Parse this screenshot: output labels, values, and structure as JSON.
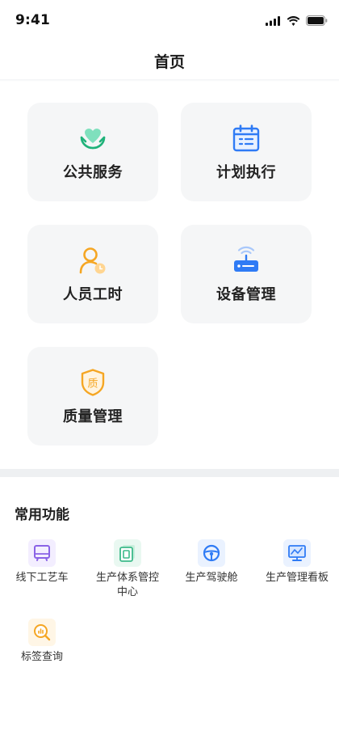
{
  "status_bar": {
    "time": "9:41"
  },
  "nav": {
    "title": "首页"
  },
  "tiles": [
    {
      "label": "公共服务",
      "icon": "heart-hands-icon",
      "color": "#3fcf9a"
    },
    {
      "label": "计划执行",
      "icon": "calendar-icon",
      "color": "#2f7bf5"
    },
    {
      "label": "人员工时",
      "icon": "person-clock-icon",
      "color": "#f5a623"
    },
    {
      "label": "设备管理",
      "icon": "router-device-icon",
      "color": "#2f7bf5"
    },
    {
      "label": "质量管理",
      "icon": "quality-shield-icon",
      "color": "#f5a623"
    }
  ],
  "common": {
    "title": "常用功能",
    "items": [
      {
        "label": "线下工艺车",
        "icon": "vehicle-icon",
        "color": "#8a63e6"
      },
      {
        "label": "生产体系管控中心",
        "icon": "control-center-icon",
        "color": "#3dba8a"
      },
      {
        "label": "生产驾驶舱",
        "icon": "steering-wheel-icon",
        "color": "#2f7bf5"
      },
      {
        "label": "生产管理看板",
        "icon": "monitor-board-icon",
        "color": "#2f7bf5"
      },
      {
        "label": "标签查询",
        "icon": "chart-search-icon",
        "color": "#f5a623"
      }
    ]
  }
}
